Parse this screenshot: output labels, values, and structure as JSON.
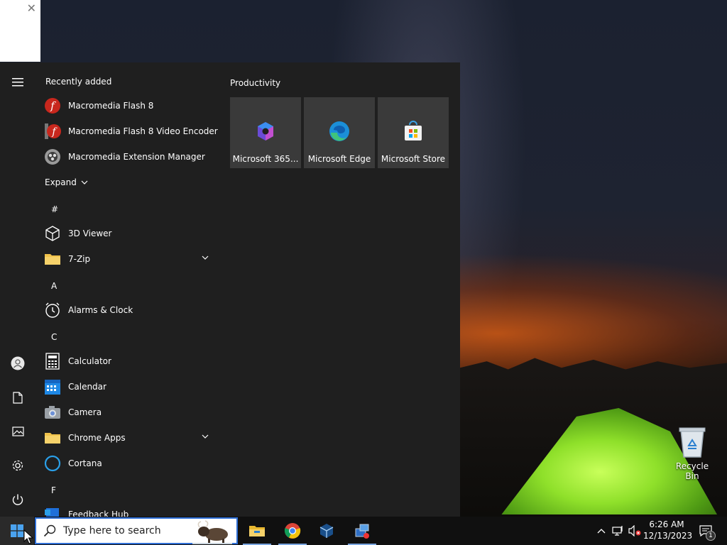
{
  "start_menu": {
    "recently_added_title": "Recently added",
    "recent_apps": [
      {
        "label": "Macromedia Flash 8",
        "icon": "flash-icon"
      },
      {
        "label": "Macromedia Flash 8 Video Encoder",
        "icon": "flash-video-encoder-icon"
      },
      {
        "label": "Macromedia Extension Manager",
        "icon": "extension-manager-icon"
      }
    ],
    "expand_label": "Expand",
    "groups": [
      {
        "letter": "#",
        "apps": [
          {
            "label": "3D Viewer",
            "icon": "3d-cube-icon"
          },
          {
            "label": "7-Zip",
            "icon": "folder-icon",
            "expandable": true
          }
        ]
      },
      {
        "letter": "A",
        "apps": [
          {
            "label": "Alarms & Clock",
            "icon": "clock-icon"
          }
        ]
      },
      {
        "letter": "C",
        "apps": [
          {
            "label": "Calculator",
            "icon": "calculator-icon"
          },
          {
            "label": "Calendar",
            "icon": "calendar-icon"
          },
          {
            "label": "Camera",
            "icon": "camera-icon"
          },
          {
            "label": "Chrome Apps",
            "icon": "folder-icon",
            "expandable": true
          },
          {
            "label": "Cortana",
            "icon": "cortana-icon"
          }
        ]
      },
      {
        "letter": "F",
        "apps": [
          {
            "label": "Feedback Hub",
            "icon": "feedback-icon"
          }
        ]
      }
    ],
    "tiles_group_title": "Productivity",
    "tiles": [
      {
        "label": "Microsoft 365...",
        "icon": "microsoft365-icon"
      },
      {
        "label": "Microsoft Edge",
        "icon": "edge-icon"
      },
      {
        "label": "Microsoft Store",
        "icon": "store-icon"
      }
    ],
    "rail": [
      "hamburger-menu-icon",
      "user-icon",
      "document-icon",
      "pictures-icon",
      "gear-icon",
      "power-icon"
    ]
  },
  "taskbar": {
    "search_placeholder": "Type here to search",
    "pinned": [
      "file-explorer-icon",
      "chrome-icon",
      "virtualbox-icon",
      "network-app-icon"
    ],
    "clock_time": "6:26 AM",
    "clock_date": "12/13/2023",
    "notification_count": "1"
  },
  "desktop": {
    "recycle_bin_label": "Recycle Bin"
  },
  "colors": {
    "menu_bg": "#1f1f1f",
    "tile_bg": "#3a3a3a",
    "taskbar_bg": "#101010",
    "search_border": "#2f6fd6"
  }
}
